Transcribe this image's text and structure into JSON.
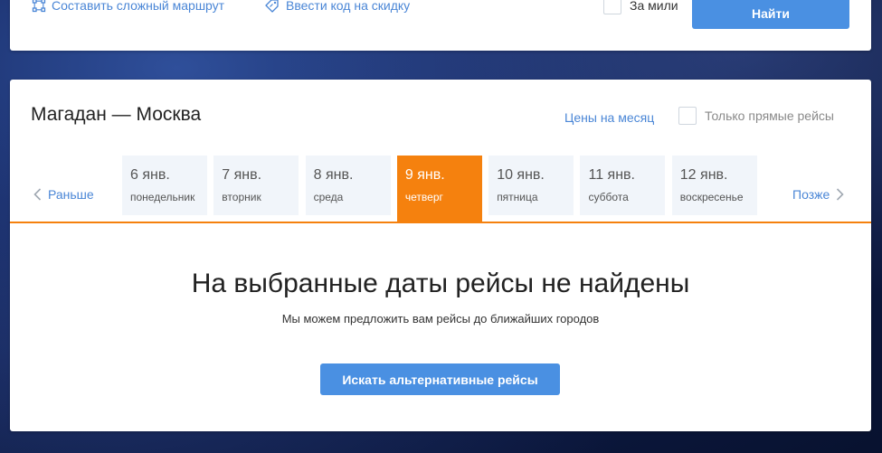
{
  "search": {
    "complex_route_label": "Составить сложный маршрут",
    "promo_code_label": "Ввести код на скидку",
    "miles_label": "За мили",
    "search_button": "Найти"
  },
  "results": {
    "route_title": "Магадан — Москва",
    "month_prices_link": "Цены на месяц",
    "direct_only_label": "Только прямые рейсы",
    "earlier_label": "Раньше",
    "later_label": "Позже",
    "days": [
      {
        "date": "6 янв.",
        "weekday": "понедельник"
      },
      {
        "date": "7 янв.",
        "weekday": "вторник"
      },
      {
        "date": "8 янв.",
        "weekday": "среда"
      },
      {
        "date": "9 янв.",
        "weekday": "четверг"
      },
      {
        "date": "10 янв.",
        "weekday": "пятница"
      },
      {
        "date": "11 янв.",
        "weekday": "суббота"
      },
      {
        "date": "12 янв.",
        "weekday": "воскресенье"
      }
    ],
    "selected_day_index": 3,
    "empty_title": "На выбранные даты рейсы не найдены",
    "empty_subtitle": "Мы можем предложить вам рейсы до ближайших городов",
    "alt_button": "Искать альтернативные рейсы"
  },
  "colors": {
    "accent_blue": "#4a90e2",
    "link_blue": "#4a86d6",
    "selected_orange": "#f5810e"
  },
  "icons": {
    "route": "route-nodes-icon",
    "promo": "tag-icon",
    "prev": "chevron-left-icon",
    "next": "chevron-right-icon"
  }
}
